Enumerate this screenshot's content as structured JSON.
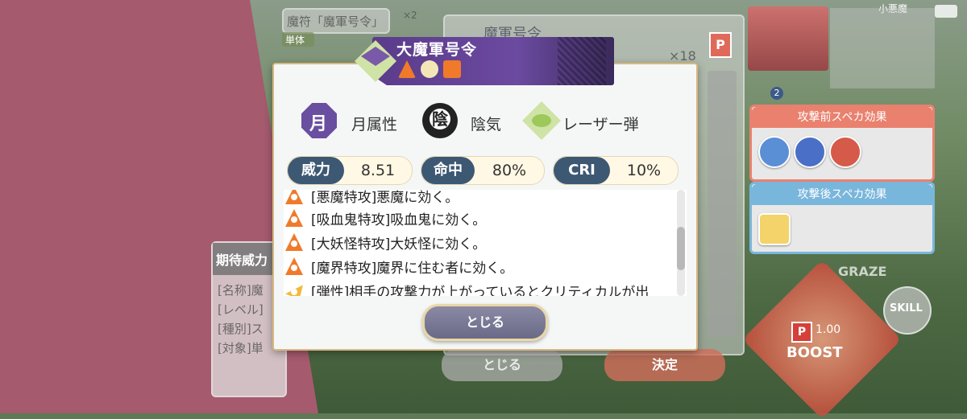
{
  "background": {
    "card_title": "魔符「魔軍号令」",
    "card_count": "×2",
    "card_target": "単体",
    "skill_header": "魔軍号令",
    "skill_count": "×18",
    "character_name": "小悪魔",
    "level_badge": "2",
    "expected_power_title": "期待威力",
    "info_lines": [
      "[名称]魔",
      "[レベル]",
      "[種別]ス",
      "[対象]単"
    ],
    "pre_effect_title": "攻撃前スペカ効果",
    "post_effect_title": "攻撃後スペカ効果",
    "graze_label": "GRAZE",
    "skill_label": "SKILL",
    "boost_label": "BOOST",
    "boost_value": "1.00",
    "back_close_label": "とじる",
    "decide_label": "決定"
  },
  "dialog": {
    "title": "大魔軍号令",
    "attributes": [
      {
        "icon": "moon-icon",
        "glyph": "月",
        "label": "月属性"
      },
      {
        "icon": "yin-icon",
        "glyph": "陰",
        "label": "陰気"
      },
      {
        "icon": "laser-icon",
        "label": "レーザー弾"
      }
    ],
    "stats": [
      {
        "key": "威力",
        "value": "8.51"
      },
      {
        "key": "命中",
        "value": "80%"
      },
      {
        "key": "CRI",
        "value": "10%"
      }
    ],
    "effects": [
      {
        "icon": "fire-icon",
        "text": "[悪魔特攻]悪魔に効く。"
      },
      {
        "icon": "fire-icon",
        "text": "[吸血鬼特攻]吸血鬼に効く。"
      },
      {
        "icon": "fire-icon",
        "text": "[大妖怪特攻]大妖怪に効く。"
      },
      {
        "icon": "fire-icon",
        "text": "[魔界特攻]魔界に住む者に効く。"
      },
      {
        "icon": "spark-icon",
        "text": "[弾性]相手の攻撃力が上がっているとクリティカルが出"
      }
    ],
    "close_label": "とじる",
    "colors": {
      "title_bar": "#6b4aa0",
      "stat_key": "#3d5873",
      "accent_border": "#d6b77f"
    }
  }
}
